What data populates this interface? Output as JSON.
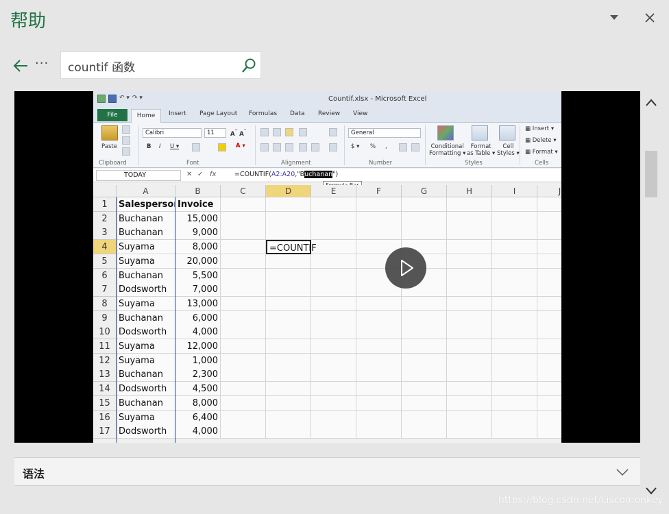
{
  "header": {
    "title": "帮助"
  },
  "search": {
    "value": "countif 函数"
  },
  "nav": {
    "more": "···"
  },
  "excel": {
    "window_title": "Countif.xlsx - Microsoft Excel",
    "tabs": [
      "File",
      "Home",
      "Insert",
      "Page Layout",
      "Formulas",
      "Data",
      "Review",
      "View"
    ],
    "ribbon": {
      "groups": [
        "Clipboard",
        "Font",
        "Alignment",
        "Number",
        "Styles",
        "Cells"
      ],
      "paste": "Paste",
      "font_name": "Calibri",
      "font_size": "11",
      "number_format": "General",
      "conditional_formatting": [
        "Conditional",
        "Formatting ▾"
      ],
      "format_as_table": [
        "Format",
        "as Table ▾"
      ],
      "cell_styles": [
        "Cell",
        "Styles ▾"
      ],
      "insert": "Insert ▾",
      "delete": "Delete ▾",
      "format": "Format ▾"
    },
    "name_box": "TODAY",
    "formula_parts": {
      "pre": "=COUNTIF(",
      "ref": "A2:A20",
      "mid": ",\"",
      "sel_b": "B",
      "sel": "uchanan",
      "post": "\")"
    },
    "tooltip": "Formula Bar",
    "columns": [
      "A",
      "B",
      "C",
      "D",
      "E",
      "F",
      "G",
      "H",
      "I",
      "J"
    ],
    "active_column": "D",
    "active_row": 4,
    "editing_cell_text": "=COUNTIF",
    "rows": [
      {
        "n": "1",
        "a": "Salesperson",
        "b": "Invoice"
      },
      {
        "n": "2",
        "a": "Buchanan",
        "b": "15,000"
      },
      {
        "n": "3",
        "a": "Buchanan",
        "b": "9,000"
      },
      {
        "n": "4",
        "a": "Suyama",
        "b": "8,000"
      },
      {
        "n": "5",
        "a": "Suyama",
        "b": "20,000"
      },
      {
        "n": "6",
        "a": "Buchanan",
        "b": "5,500"
      },
      {
        "n": "7",
        "a": "Dodsworth",
        "b": "7,000"
      },
      {
        "n": "8",
        "a": "Suyama",
        "b": "13,000"
      },
      {
        "n": "9",
        "a": "Buchanan",
        "b": "6,000"
      },
      {
        "n": "10",
        "a": "Dodsworth",
        "b": "4,000"
      },
      {
        "n": "11",
        "a": "Suyama",
        "b": "12,000"
      },
      {
        "n": "12",
        "a": "Suyama",
        "b": "1,000"
      },
      {
        "n": "13",
        "a": "Buchanan",
        "b": "2,300"
      },
      {
        "n": "14",
        "a": "Dodsworth",
        "b": "4,500"
      },
      {
        "n": "15",
        "a": "Buchanan",
        "b": "8,000"
      },
      {
        "n": "16",
        "a": "Suyama",
        "b": "6,400"
      },
      {
        "n": "17",
        "a": "Dodsworth",
        "b": "4,000"
      }
    ]
  },
  "section": {
    "title": "语法"
  },
  "watermark": "https://blog.csdn.net/ciscomonkey",
  "colors": {
    "accent": "#217346",
    "active_header": "#f0d67a"
  }
}
